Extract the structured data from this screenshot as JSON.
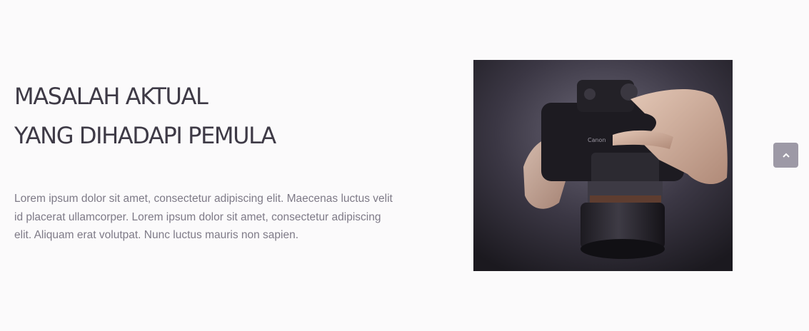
{
  "section": {
    "heading_line1": "MASALAH AKTUAL",
    "heading_line2": "YANG DIHADAPI PEMULA",
    "body": "Lorem ipsum dolor sit amet, consectetur adipiscing elit. Maecenas luctus velit id placerat ullamcorper. Lorem ipsum dolor sit amet, consectetur adipiscing elit. Aliquam erat volutpat. Nunc luctus mauris non sapien."
  },
  "photo": {
    "brand_text": "Canon"
  },
  "scroll_top": {
    "icon": "chevron-up-icon"
  },
  "colors": {
    "background": "#fbfafb",
    "heading": "#3e3a46",
    "body_text": "#7e7a87",
    "scroll_button": "#9d99a6"
  }
}
